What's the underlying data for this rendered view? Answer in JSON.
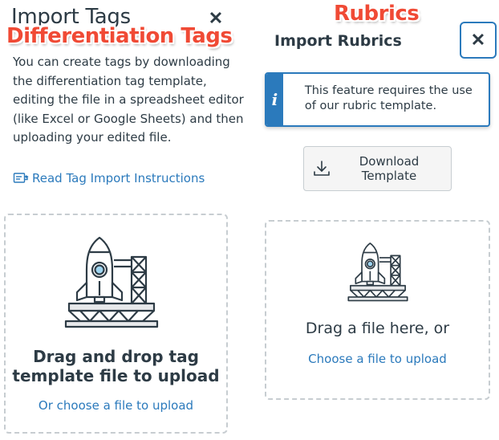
{
  "annotations": {
    "left": "Differentiation Tags",
    "right": "Rubrics"
  },
  "tags_modal": {
    "title": "Import Tags",
    "close_icon": "close-icon",
    "close_glyph": "✕",
    "description": "You can create tags by downloading the differentiation tag template, editing the file in a spreadsheet editor (like Excel or Google Sheets) and then uploading your edited file.",
    "instructions_link": "Read Tag Import Instructions",
    "instructions_icon": "document-icon",
    "dropzone": {
      "illustration": "rocket-launch-icon",
      "main_text": "Drag and drop tag template file to upload",
      "link_text": "Or choose a file to upload"
    }
  },
  "rubrics_modal": {
    "title": "Import Rubrics",
    "close_icon": "close-icon",
    "close_glyph": "✕",
    "alert": {
      "icon": "info-icon",
      "icon_glyph": "i",
      "text": "This feature requires the use of our rubric template."
    },
    "download_button": {
      "icon": "download-icon",
      "label": "Download Template"
    },
    "dropzone": {
      "illustration": "rocket-launch-icon",
      "main_text": "Drag a file here, or",
      "link_text": "Choose a file to upload"
    }
  },
  "colors": {
    "text": "#2d3b45",
    "link": "#2b7abc",
    "annotation": "#f04a35",
    "dashed_border": "#c7cdd1"
  }
}
